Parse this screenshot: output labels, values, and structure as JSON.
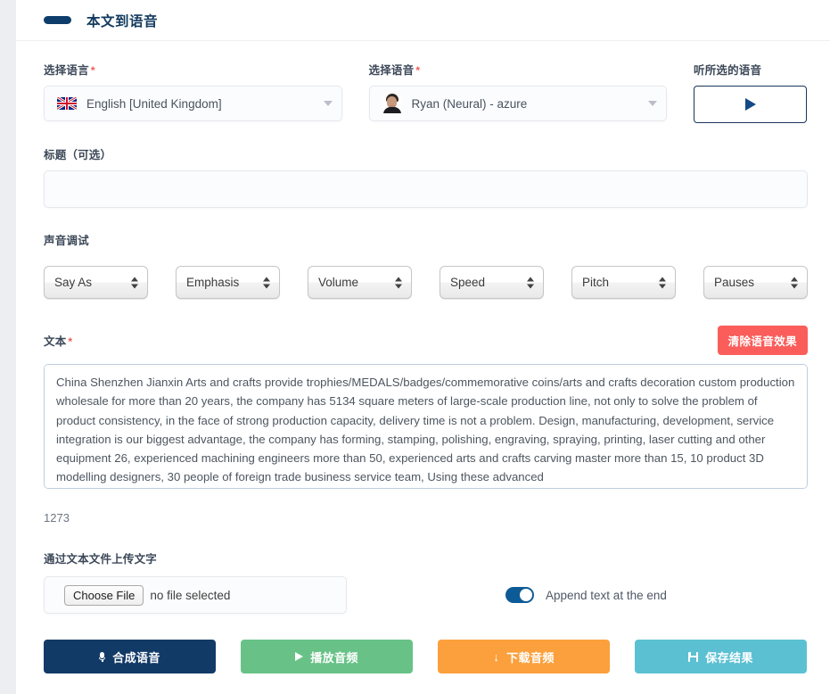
{
  "header": {
    "title": "本文到语音"
  },
  "language": {
    "label": "选择语言",
    "required_mark": "*",
    "value": "English [United Kingdom]",
    "flag_icon": "uk-flag-icon"
  },
  "voice": {
    "label": "选择语音",
    "required_mark": "*",
    "value": "Ryan (Neural) - azure",
    "avatar_icon": "voice-avatar-icon"
  },
  "listen": {
    "label": "听所选的语音",
    "play_icon": "play-icon"
  },
  "title_field": {
    "label": "标题（可选）",
    "value": "",
    "placeholder": ""
  },
  "tuning": {
    "label": "声音调试",
    "selects": [
      {
        "name": "say-as",
        "value": "Say As"
      },
      {
        "name": "emphasis",
        "value": "Emphasis"
      },
      {
        "name": "volume",
        "value": "Volume"
      },
      {
        "name": "speed",
        "value": "Speed"
      },
      {
        "name": "pitch",
        "value": "Pitch"
      },
      {
        "name": "pauses",
        "value": "Pauses"
      }
    ]
  },
  "text_area": {
    "label": "文本",
    "required_mark": "*",
    "clear_button": "清除语音效果",
    "value": "China Shenzhen Jianxin Arts and crafts provide trophies/MEDALS/badges/commemorative coins/arts and crafts decoration custom production wholesale for more than 20 years, the company has 5134 square meters of large-scale production line, not only to solve the problem of product consistency, in the face of strong production capacity, delivery time is not a problem. Design, manufacturing, development, service integration is our biggest advantage, the company has forming, stamping, polishing, engraving, spraying, printing, laser cutting and other equipment 26, experienced machining engineers more than 50, experienced arts and crafts carving master more than 15, 10 product 3D modelling designers, 30 people of foreign trade business service team, Using these advanced",
    "char_count": "1273"
  },
  "upload": {
    "label": "通过文本文件上传文字",
    "choose_file_button": "Choose File",
    "no_file_text": "no file selected"
  },
  "append": {
    "label": "Append text at the end",
    "enabled": true
  },
  "actions": [
    {
      "name": "synthesize-voice",
      "label": "合成语音",
      "icon": "microphone-icon",
      "color": "#123a67"
    },
    {
      "name": "play-audio",
      "label": "播放音频",
      "icon": "play-icon",
      "color": "#68c287"
    },
    {
      "name": "download-audio",
      "label": "下载音频",
      "icon": "download-arrow-icon",
      "color": "#fba03c"
    },
    {
      "name": "save-result",
      "label": "保存结果",
      "icon": "save-disk-icon",
      "color": "#5cc0d3"
    }
  ],
  "colors": {
    "brand_dark": "#123a67",
    "danger": "#fb5d5a",
    "success": "#68c287",
    "warning": "#fba03c",
    "info": "#5cc0d3",
    "toggle_on": "#0d5b96"
  }
}
